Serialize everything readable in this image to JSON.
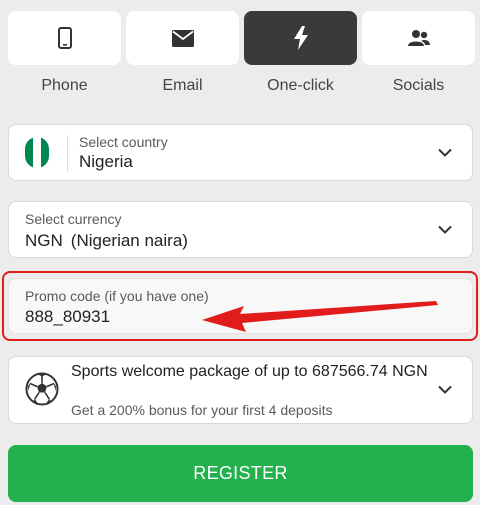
{
  "tabs": [
    {
      "label": "Phone",
      "icon": "phone-icon"
    },
    {
      "label": "Email",
      "icon": "envelope-icon"
    },
    {
      "label": "One-click",
      "icon": "lightning-icon",
      "active": true
    },
    {
      "label": "Socials",
      "icon": "users-icon"
    }
  ],
  "country": {
    "label": "Select country",
    "value": "Nigeria",
    "flag_colors": [
      "#008751",
      "#ffffff",
      "#008751"
    ]
  },
  "currency": {
    "label": "Select currency",
    "code": "NGN",
    "name": "(Nigerian naira)"
  },
  "promo": {
    "label": "Promo code (if you have one)",
    "value": "888_80931"
  },
  "bonus": {
    "title": "Sports welcome package of up to 687566.74 NGN",
    "description": "Get a 200% bonus for your first 4 deposits",
    "icon": "soccer-ball-icon"
  },
  "register": {
    "label": "REGISTER"
  },
  "colors": {
    "accent_green": "#22b14c",
    "highlight_red": "#e21b1b",
    "active_tab": "#3a3a3a"
  }
}
